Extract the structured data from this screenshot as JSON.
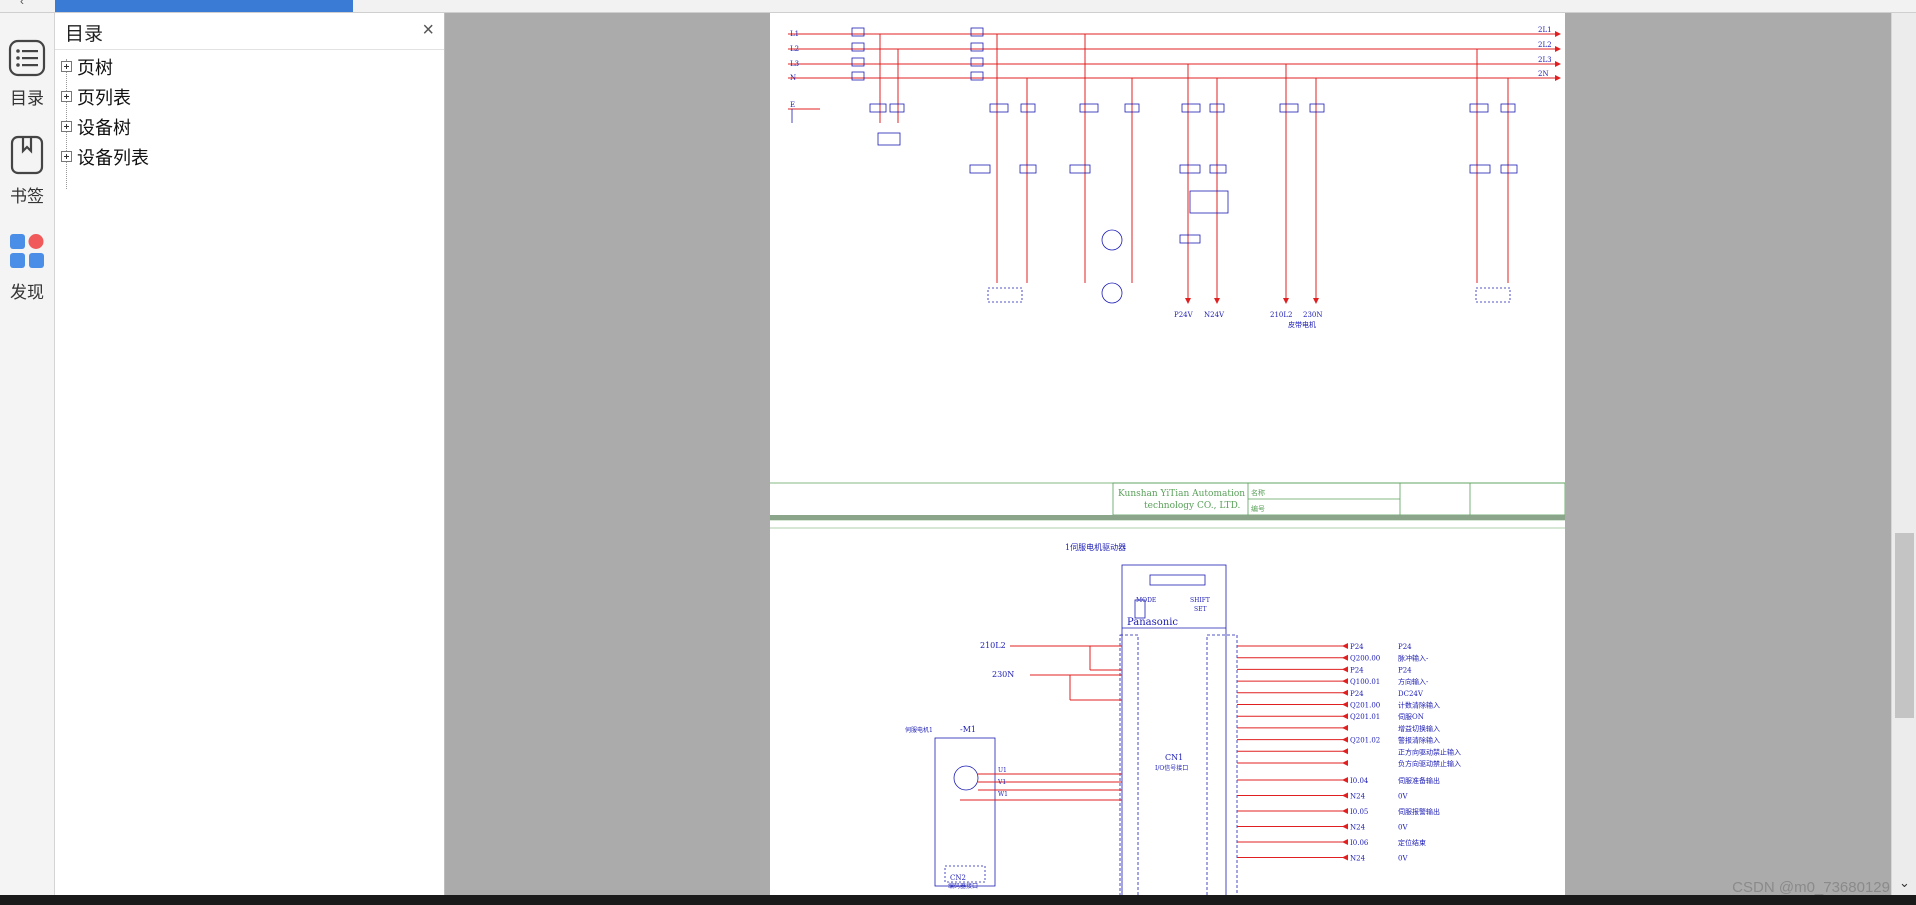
{
  "sidebar": {
    "items": [
      {
        "label": "目录",
        "icon": "toc-list-icon"
      },
      {
        "label": "书签",
        "icon": "bookmark-icon"
      },
      {
        "label": "发现",
        "icon": "discover-apps-icon"
      }
    ]
  },
  "toc": {
    "title": "目录",
    "close_symbol": "×",
    "items": [
      "页树",
      "页列表",
      "设备树",
      "设备列表"
    ]
  },
  "drawing": {
    "page1": {
      "phases_left": [
        "L1",
        "L2",
        "L3",
        "N",
        "E"
      ],
      "phases_right": [
        "2L1",
        "2L2",
        "2L3",
        "2N"
      ],
      "title_block": {
        "company_line1": "Kunshan YiTian Automation",
        "company_line2": "technology CO., LTD.",
        "name_label": "名称",
        "number_label": "编号"
      },
      "bottom_labels": [
        "P24V",
        "N24V",
        "210L2",
        "230N"
      ],
      "conveyor_label": "皮带电机"
    },
    "page2": {
      "driver_title": "1伺服电机驱动器",
      "brand": "Panasonic",
      "buttons": [
        "MODE",
        "SHIFT",
        "SET"
      ],
      "connector_label": "CN1",
      "connector_sub": "I/O信号接口",
      "motor_label": "-M1",
      "motor_sub": "伺服电机1",
      "power_in": [
        "210L2",
        "230N"
      ],
      "uvw": [
        "U1",
        "V1",
        "W1"
      ],
      "encoder_label": "CN2",
      "encoder_sub": "编码器接口",
      "signals": [
        {
          "tag": "P24",
          "desc": "P24"
        },
        {
          "tag": "Q200.00",
          "desc": "脉冲输入-"
        },
        {
          "tag": "P24",
          "desc": "P24"
        },
        {
          "tag": "Q100.01",
          "desc": "方向输入-"
        },
        {
          "tag": "P24",
          "desc": "DC24V"
        },
        {
          "tag": "Q201.00",
          "desc": "计数清除输入"
        },
        {
          "tag": "Q201.01",
          "desc": "伺服ON"
        },
        {
          "tag": "",
          "desc": "增益切换输入"
        },
        {
          "tag": "Q201.02",
          "desc": "警报清除输入"
        },
        {
          "tag": "",
          "desc": "正方向驱动禁止输入"
        },
        {
          "tag": "",
          "desc": "负方向驱动禁止输入"
        }
      ],
      "outputs": [
        {
          "tag": "I0.04",
          "desc": "伺服准备输出"
        },
        {
          "tag": "N24",
          "desc": "0V"
        },
        {
          "tag": "I0.05",
          "desc": "伺服报警输出"
        },
        {
          "tag": "N24",
          "desc": "0V"
        },
        {
          "tag": "I0.06",
          "desc": "定位结束"
        },
        {
          "tag": "N24",
          "desc": "0V"
        }
      ]
    }
  },
  "watermark": "CSDN @m0_73680129",
  "colors": {
    "wire": "#e02020",
    "ink": "#1c1cb4",
    "titleblock": "#5aa05a",
    "tab_active": "#3a7bd5"
  }
}
